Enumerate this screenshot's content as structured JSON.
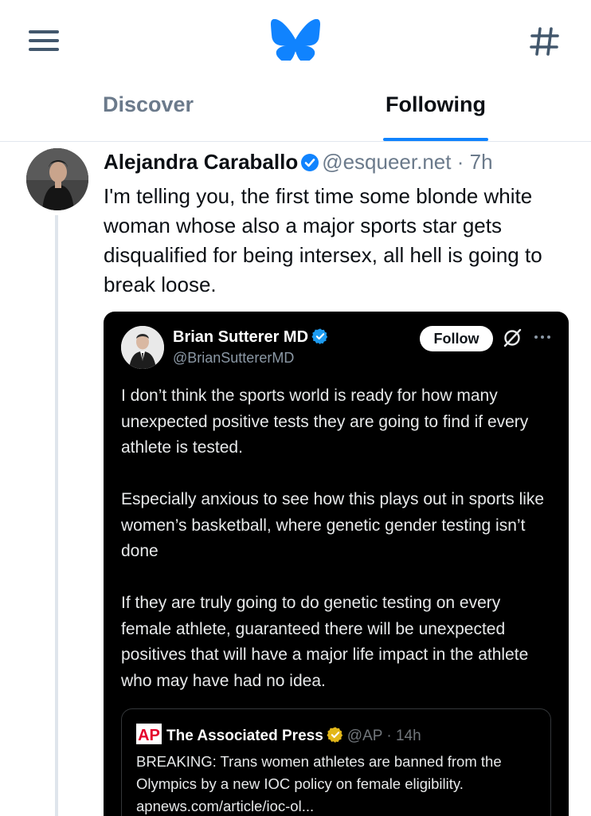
{
  "nav": {
    "menu_icon": "hamburger-menu-icon",
    "logo_icon": "butterfly-logo-icon",
    "feeds_icon": "hash-icon",
    "brand_color": "#1083fe"
  },
  "tabs": [
    {
      "label": "Discover",
      "active": false
    },
    {
      "label": "Following",
      "active": true
    }
  ],
  "post": {
    "author_name": "Alejandra Caraballo",
    "verified": true,
    "handle": "@esqueer.net",
    "separator": "·",
    "time": "7h",
    "text": "I'm telling you, the first time some blonde white woman whose also a major sports star gets disqualified for being intersex, all hell is going to break loose."
  },
  "embed": {
    "author_name": "Brian Sutterer MD",
    "handle": "@BrianSuttererMD",
    "follow_label": "Follow",
    "more_icon": "more-dots-icon",
    "grok_icon": "grok-icon",
    "paragraphs": [
      "I don’t think the sports world is ready for how many unexpected positive tests they are going to find if every athlete is tested.",
      "Especially anxious to see how this plays out in sports like women’s basketball, where genetic gender testing isn’t done",
      "If they are truly going to do genetic testing on every female athlete, guaranteed there will be unexpected positives that will have a major life impact in the athlete who may have had no idea."
    ],
    "quote": {
      "logo_text": "AP",
      "author_name": "The Associated Press",
      "handle": "@AP",
      "separator": "·",
      "time": "14h",
      "text": "BREAKING: Trans women athletes are banned from the Olympics by a new IOC policy on female eligibility. apnews.com/article/ioc-ol..."
    }
  }
}
